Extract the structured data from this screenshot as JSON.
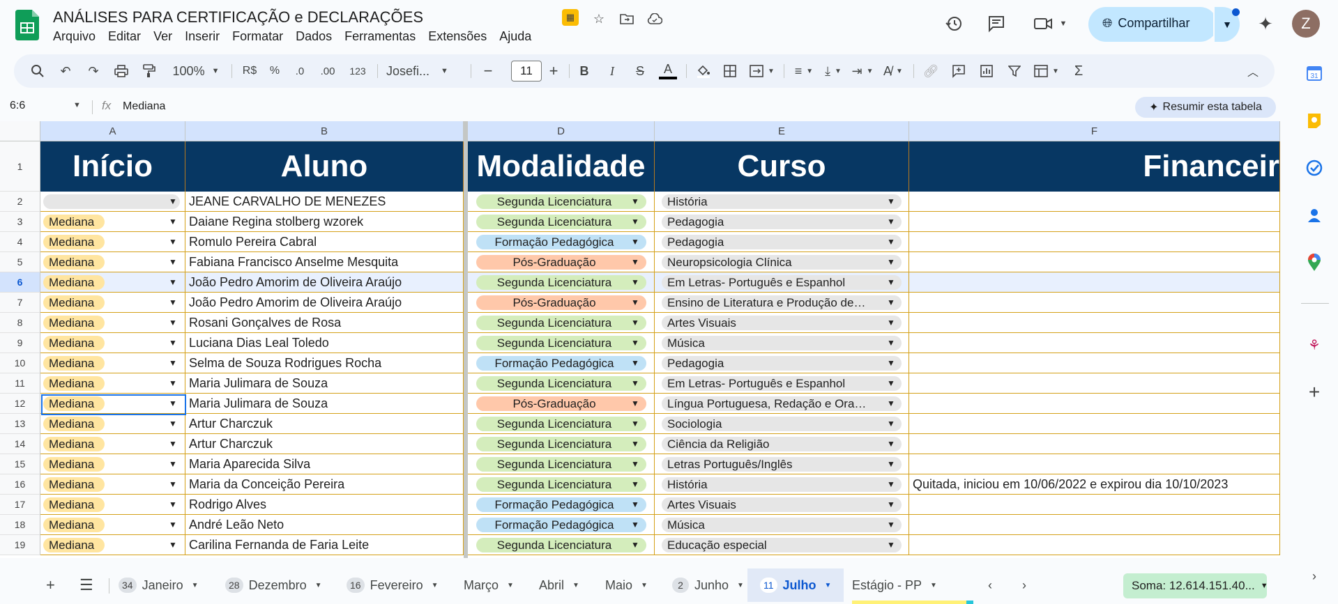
{
  "title_bar": {
    "doc_title": "ANÁLISES PARA CERTIFICAÇÃO e DECLARAÇÕES",
    "menu": [
      "Arquivo",
      "Editar",
      "Ver",
      "Inserir",
      "Formatar",
      "Dados",
      "Ferramentas",
      "Extensões",
      "Ajuda"
    ],
    "share_label": "Compartilhar",
    "avatar_initial": "Z"
  },
  "toolbar": {
    "zoom": "100%",
    "currency": "R$",
    "percent": "%",
    "dec_decrease": ".0",
    "dec_increase": ".00",
    "number_format": "123",
    "font_name": "Josefi...",
    "font_size": "11",
    "bold": "B",
    "italic": "I",
    "text_color_label": "A"
  },
  "formula_bar": {
    "name_box": "6:6",
    "fx_label": "fx",
    "content": "Mediana",
    "summarize_button": "Resumir esta tabela"
  },
  "columns": [
    "A",
    "B",
    "D",
    "E",
    "F"
  ],
  "header_row": {
    "row_number": "1",
    "cells": [
      "Início",
      "Aluno",
      "Modalidade",
      "Curso",
      "Financeir"
    ]
  },
  "rows": [
    {
      "n": "2",
      "inicio": "",
      "aluno": "JEANE CARVALHO DE MENEZES",
      "modalidade": "Segunda Licenciatura",
      "curso": "História",
      "financeiro": ""
    },
    {
      "n": "3",
      "inicio": "Mediana",
      "aluno": "Daiane Regina stolberg wzorek",
      "modalidade": "Segunda Licenciatura",
      "curso": "Pedagogia",
      "financeiro": ""
    },
    {
      "n": "4",
      "inicio": "Mediana",
      "aluno": "Romulo Pereira Cabral",
      "modalidade": "Formação Pedagógica",
      "curso": "Pedagogia",
      "financeiro": ""
    },
    {
      "n": "5",
      "inicio": "Mediana",
      "aluno": "Fabiana Francisco Anselme Mesquita",
      "modalidade": "Pós-Graduação",
      "curso": "Neuropsicologia Clínica",
      "financeiro": ""
    },
    {
      "n": "6",
      "inicio": "Mediana",
      "aluno": "João Pedro Amorim de Oliveira Araújo",
      "modalidade": "Segunda Licenciatura",
      "curso": "Em Letras- Português e Espanhol",
      "financeiro": ""
    },
    {
      "n": "7",
      "inicio": "Mediana",
      "aluno": "João Pedro Amorim de Oliveira Araújo",
      "modalidade": "Pós-Graduação",
      "curso": "Ensino de Literatura e Produção de…",
      "financeiro": ""
    },
    {
      "n": "8",
      "inicio": "Mediana",
      "aluno": "Rosani Gonçalves de Rosa",
      "modalidade": "Segunda Licenciatura",
      "curso": "Artes Visuais",
      "financeiro": ""
    },
    {
      "n": "9",
      "inicio": "Mediana",
      "aluno": "Luciana Dias Leal Toledo",
      "modalidade": "Segunda Licenciatura",
      "curso": "Música",
      "financeiro": ""
    },
    {
      "n": "10",
      "inicio": "Mediana",
      "aluno": "Selma  de Souza Rodrigues Rocha",
      "modalidade": "Formação Pedagógica",
      "curso": "Pedagogia",
      "financeiro": ""
    },
    {
      "n": "11",
      "inicio": "Mediana",
      "aluno": "Maria Julimara de Souza",
      "modalidade": "Segunda Licenciatura",
      "curso": "Em Letras- Português e Espanhol",
      "financeiro": ""
    },
    {
      "n": "12",
      "inicio": "Mediana",
      "aluno": "Maria Julimara de Souza",
      "modalidade": "Pós-Graduação",
      "curso": "Língua Portuguesa, Redação e Ora…",
      "financeiro": ""
    },
    {
      "n": "13",
      "inicio": "Mediana",
      "aluno": "Artur Charczuk",
      "modalidade": "Segunda Licenciatura",
      "curso": "Sociologia",
      "financeiro": ""
    },
    {
      "n": "14",
      "inicio": "Mediana",
      "aluno": "Artur Charczuk",
      "modalidade": "Segunda Licenciatura",
      "curso": "Ciência da Religião",
      "financeiro": ""
    },
    {
      "n": "15",
      "inicio": "Mediana",
      "aluno": "Maria Aparecida Silva",
      "modalidade": "Segunda Licenciatura",
      "curso": "Letras Português/Inglês",
      "financeiro": ""
    },
    {
      "n": "16",
      "inicio": "Mediana",
      "aluno": "Maria da Conceição Pereira",
      "modalidade": "Segunda Licenciatura",
      "curso": "História",
      "financeiro": "Quitada, iniciou em 10/06/2022 e expirou dia 10/10/2023"
    },
    {
      "n": "17",
      "inicio": "Mediana",
      "aluno": "Rodrigo Alves",
      "modalidade": "Formação Pedagógica",
      "curso": "Artes Visuais",
      "financeiro": ""
    },
    {
      "n": "18",
      "inicio": "Mediana",
      "aluno": "André Leão Neto",
      "modalidade": "Formação Pedagógica",
      "curso": "Música",
      "financeiro": ""
    },
    {
      "n": "19",
      "inicio": "Mediana",
      "aluno": "Carilina Fernanda de Faria Leite",
      "modalidade": "Segunda Licenciatura",
      "curso": "Educação especial",
      "financeiro": ""
    }
  ],
  "selected_row": "6",
  "modalidade_colors": {
    "Segunda Licenciatura": "#d4edbc",
    "Formação Pedagógica": "#bfe1f6",
    "Pós-Graduação": "#ffc8aa"
  },
  "colors": {
    "header_bg": "#073763",
    "mediana_chip": "#ffe5a0",
    "curso_chip": "#e6e6e6",
    "grid_line": "#d4a017",
    "sum_bg": "#c4eed0"
  },
  "tabs": [
    {
      "badge": "34",
      "label": "Janeiro",
      "active": false
    },
    {
      "badge": "28",
      "label": "Dezembro",
      "active": false
    },
    {
      "badge": "16",
      "label": "Fevereiro",
      "active": false
    },
    {
      "badge": "",
      "label": "Março",
      "active": false
    },
    {
      "badge": "",
      "label": "Abril",
      "active": false
    },
    {
      "badge": "",
      "label": "Maio",
      "active": false
    },
    {
      "badge": "2",
      "label": "Junho",
      "active": false
    },
    {
      "badge": "11",
      "label": "Julho",
      "active": true
    },
    {
      "badge": "",
      "label": "Estágio - PP",
      "active": false
    }
  ],
  "sum_label": "Soma: 12.614.151.40..."
}
